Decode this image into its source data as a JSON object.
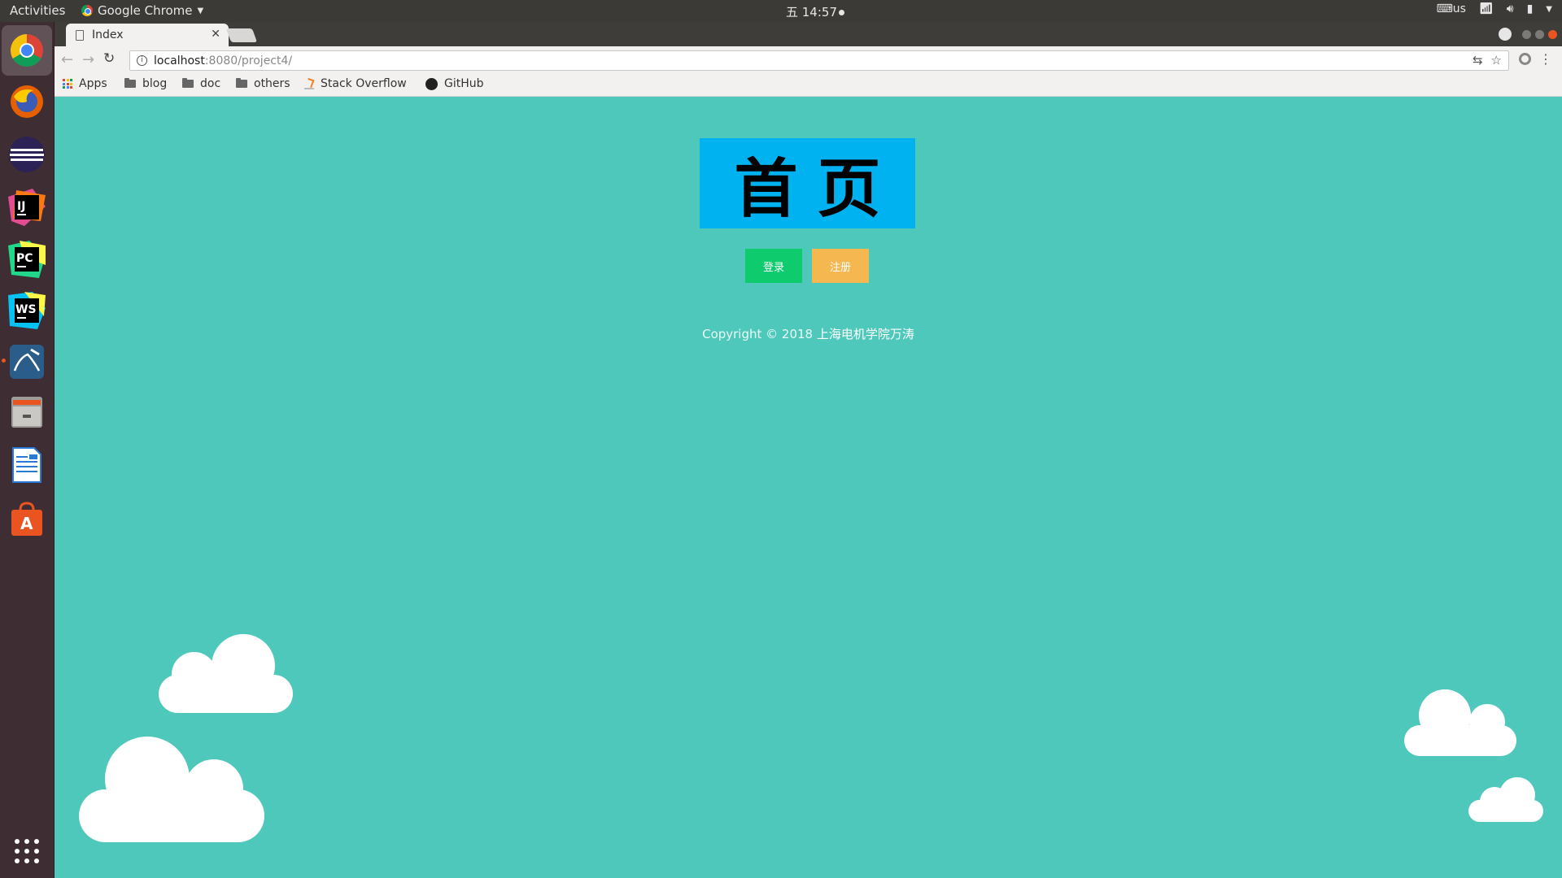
{
  "top_panel": {
    "activities": "Activities",
    "app_name": "Google Chrome",
    "clock": "五 14:57",
    "keyboard_layout": "us"
  },
  "browser": {
    "tab_title": "Index",
    "url_host": "localhost",
    "url_rest": ":8080/project4/",
    "bookmarks": [
      "Apps",
      "blog",
      "doc",
      "others",
      "Stack Overflow",
      "GitHub"
    ]
  },
  "page": {
    "hero_text": "首页",
    "login_label": "登录",
    "register_label": "注册",
    "copyright_prefix": "Copyright © 2018 ",
    "copyright_owner": "上海电机学院万涛"
  },
  "colors": {
    "background": "#4ec8bb",
    "hero": "#00b2ef",
    "login": "#0ecb6d",
    "register": "#f5b750"
  },
  "dock": {
    "apps": [
      "chrome-icon",
      "firefox-icon",
      "eclipse-icon",
      "intellij-icon",
      "pycharm-icon",
      "webstorm-icon",
      "mysql-workbench-icon",
      "files-icon",
      "writer-icon",
      "software-center-icon",
      "show-apps-icon"
    ]
  }
}
